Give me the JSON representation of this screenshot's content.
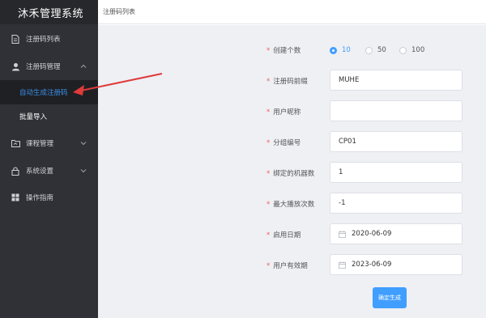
{
  "app": {
    "title": "沐禾管理系统"
  },
  "sidebar": {
    "items": [
      {
        "label": "注册码列表",
        "icon": "document-icon"
      },
      {
        "label": "注册码管理",
        "icon": "user-icon",
        "expanded": true,
        "children": [
          {
            "label": "自动生成注册码",
            "active": true
          },
          {
            "label": "批量导入",
            "active": false
          }
        ]
      },
      {
        "label": "课程管理",
        "icon": "folder-icon"
      },
      {
        "label": "系统设置",
        "icon": "lock-icon"
      },
      {
        "label": "操作指南",
        "icon": "grid-icon"
      }
    ]
  },
  "breadcrumb": {
    "current": "注册码列表"
  },
  "form": {
    "create_count": {
      "label": "创建个数",
      "options": [
        "10",
        "50",
        "100"
      ],
      "selected": "10"
    },
    "prefix": {
      "label": "注册码前缀",
      "value": "MUHE"
    },
    "nickname": {
      "label": "用户昵称",
      "value": ""
    },
    "group_code": {
      "label": "分组编号",
      "value": "CP01"
    },
    "bound_machines": {
      "label": "绑定的机器数",
      "value": "1"
    },
    "max_plays": {
      "label": "最大播放次数",
      "value": "-1"
    },
    "start_date": {
      "label": "启用日期",
      "value": "2020-06-09"
    },
    "user_expiry": {
      "label": "用户有效期",
      "value": "2023-06-09"
    },
    "required_marker": "*",
    "submit_label": "确定生成"
  },
  "colors": {
    "sidebar_bg": "#2f3136",
    "active_text": "#3a8ee6",
    "primary": "#409eff",
    "required": "#f25d5d",
    "annotation_arrow": "#e03a3a"
  }
}
